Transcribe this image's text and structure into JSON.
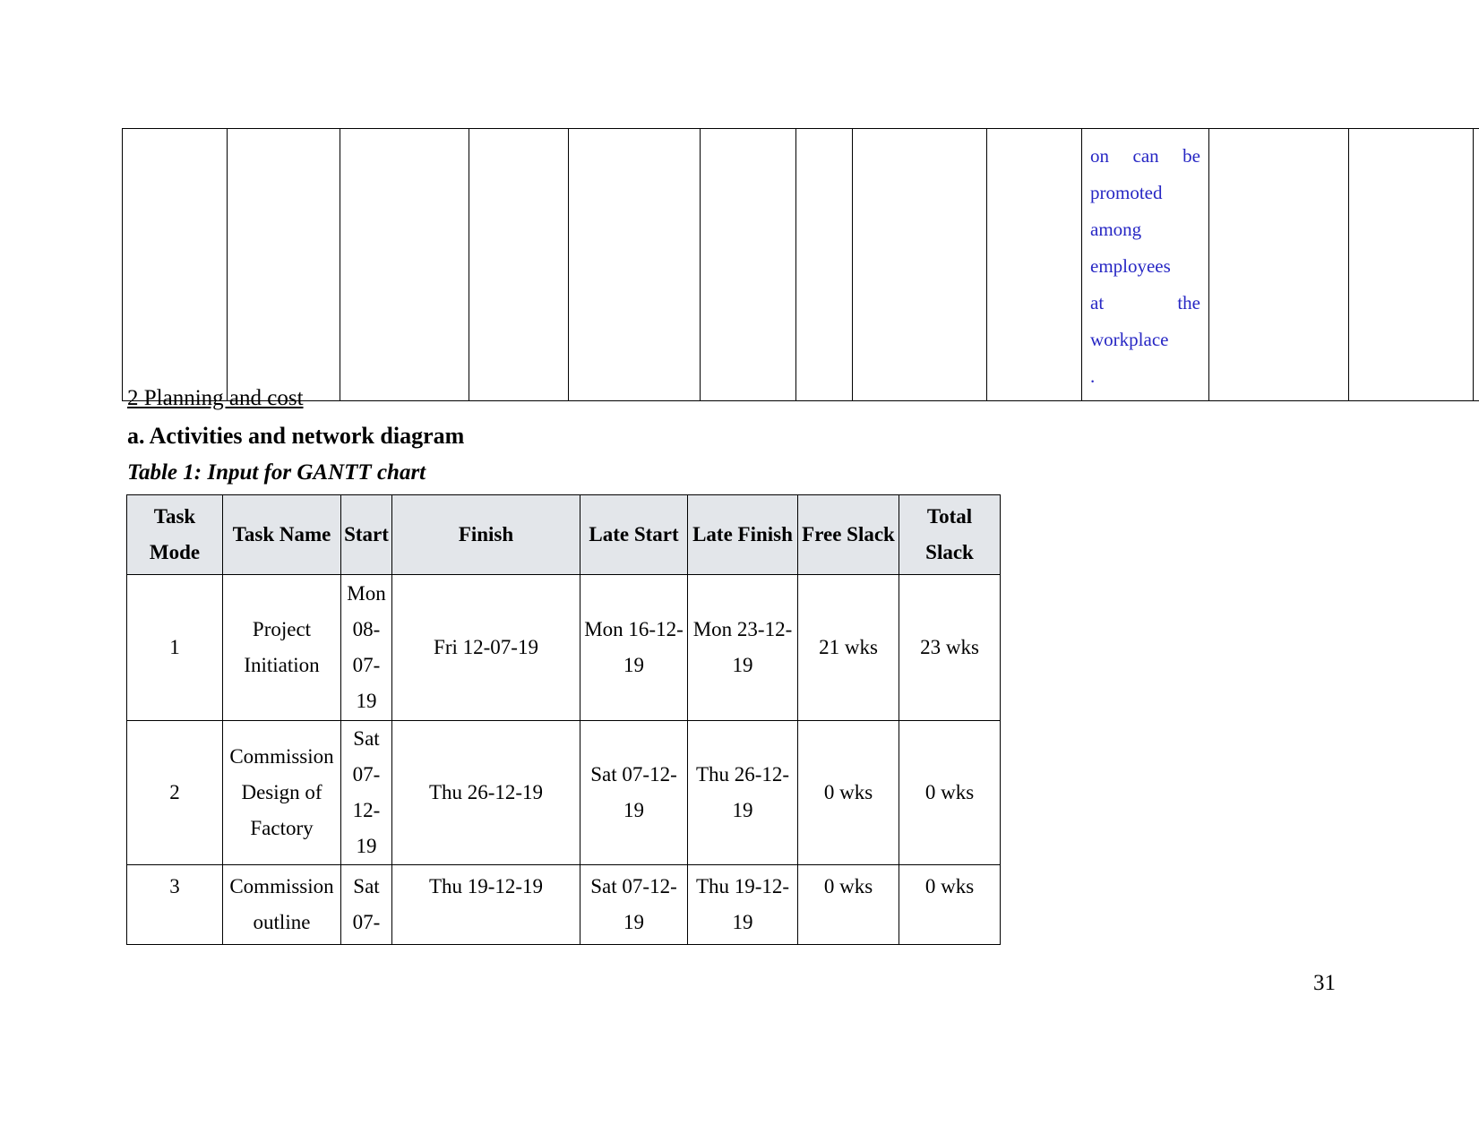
{
  "document": {
    "page_number": "31",
    "headings": {
      "section": "2 Planning and cost",
      "subsection": "a. Activities and network diagram",
      "table_caption": "Table 1: Input for GANTT chart"
    }
  },
  "continued_table": {
    "blue_text_cell": {
      "line1": "on can be",
      "line2": "promoted",
      "line3": "among",
      "line4": "employees",
      "line5": "at the",
      "line6": "workplace",
      "line7": ".",
      "color": "#2727c4"
    },
    "empty_cell_count": 12
  },
  "gantt_table": {
    "header_background": "#e3e6ea",
    "columns": [
      "Task Mode",
      "Task Name",
      "Start",
      "Finish",
      "Late Start",
      "Late Finish",
      "Free Slack",
      "Total Slack"
    ],
    "rows": [
      {
        "task_mode": "1",
        "task_name": "Project Initiation",
        "start": "Mon 08-07-19",
        "finish": "Fri 12-07-19",
        "late_start": "Mon 16-12-19",
        "late_finish": "Mon 23-12-19",
        "free_slack": "21 wks",
        "total_slack": "23 wks"
      },
      {
        "task_mode": "2",
        "task_name": "Commission Design of Factory",
        "start": "Sat 07-12-19",
        "finish": "Thu 26-12-19",
        "late_start": "Sat 07-12-19",
        "late_finish": "Thu 26-12-19",
        "free_slack": "0 wks",
        "total_slack": "0 wks"
      },
      {
        "task_mode": "3",
        "task_name": "Commission outline",
        "start": "Sat 07-",
        "finish": "Thu 19-12-19",
        "late_start": "Sat 07-12-19",
        "late_finish": "Thu 19-12-19",
        "free_slack": "0 wks",
        "total_slack": "0 wks"
      }
    ]
  }
}
